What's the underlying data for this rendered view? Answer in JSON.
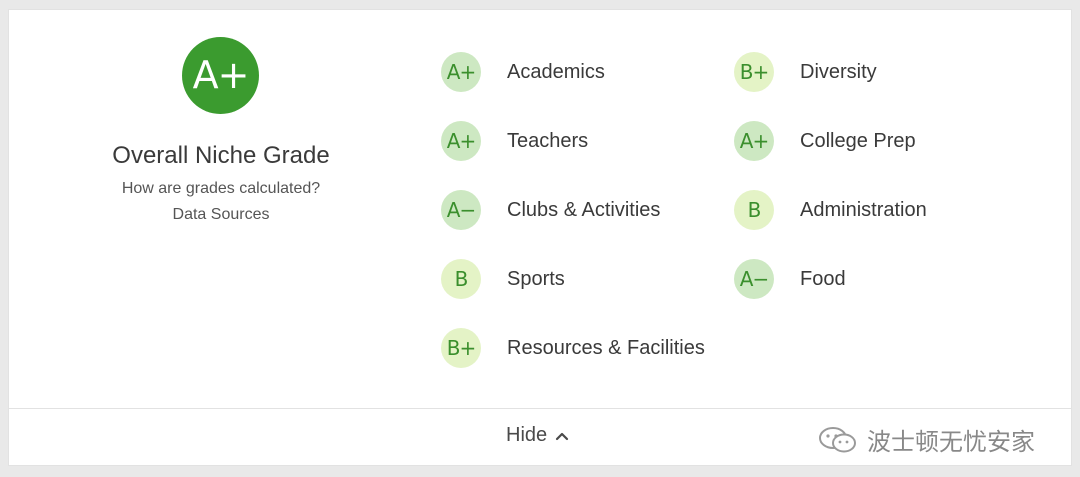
{
  "overall": {
    "grade": "A+",
    "title": "Overall Niche Grade",
    "link_calc": "How are grades calculated?",
    "link_sources": "Data Sources",
    "badge_color": "#3b9b2f"
  },
  "grades": [
    {
      "grade": "A+",
      "label": "Academics"
    },
    {
      "grade": "A+",
      "label": "Teachers"
    },
    {
      "grade": "A−",
      "label": "Clubs & Activities"
    },
    {
      "grade": "B",
      "label": "Sports"
    },
    {
      "grade": "B+",
      "label": "Resources & Facilities"
    },
    {
      "grade": "B+",
      "label": "Diversity"
    },
    {
      "grade": "A+",
      "label": "College Prep"
    },
    {
      "grade": "B",
      "label": "Administration"
    },
    {
      "grade": "A−",
      "label": "Food"
    }
  ],
  "footer": {
    "hide_label": "Hide",
    "watermark_text": "波士顿无忧安家",
    "chevron_icon": "chevron-up-icon"
  },
  "colors": {
    "a_badge_bg": "#cde8c2",
    "b_badge_bg": "#e4f3c6",
    "grade_text": "#3b8f2d"
  }
}
